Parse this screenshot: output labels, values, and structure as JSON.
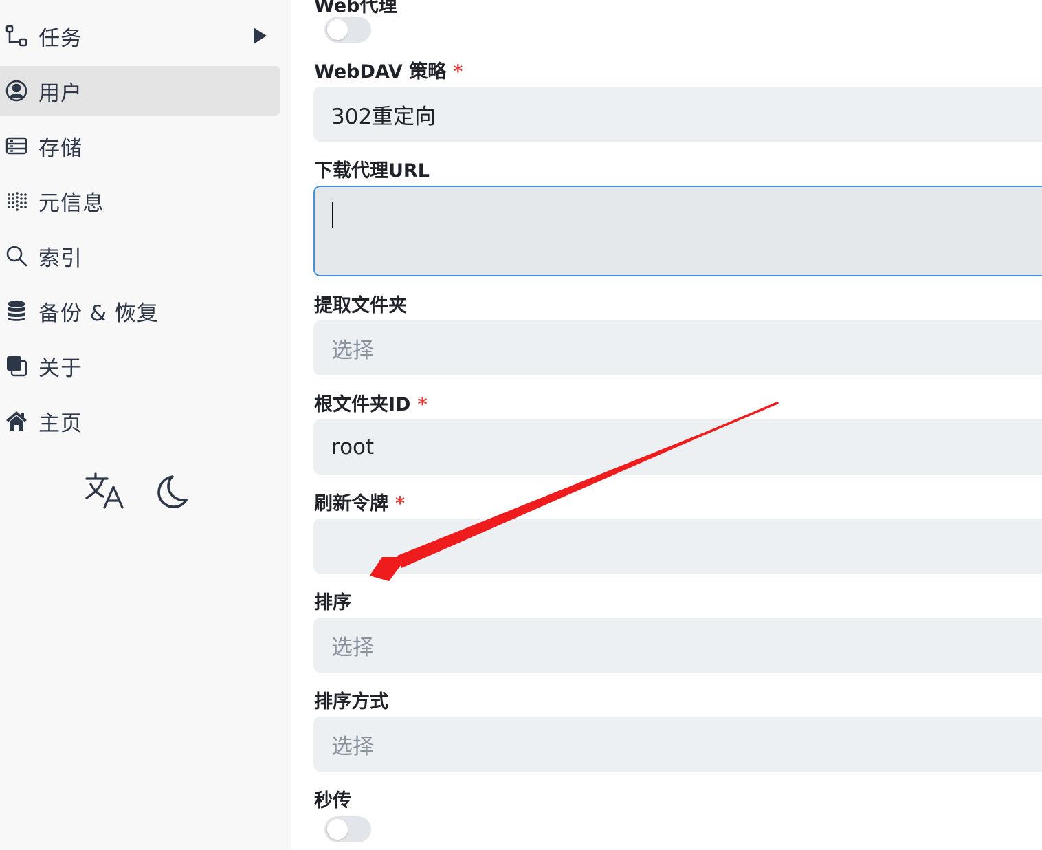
{
  "sidebar": {
    "items": [
      {
        "label": "任务",
        "icon": "flow-icon",
        "expandable": true
      },
      {
        "label": "用户",
        "icon": "user-circle-icon",
        "active": true
      },
      {
        "label": "存储",
        "icon": "storage-icon"
      },
      {
        "label": "元信息",
        "icon": "metadata-icon"
      },
      {
        "label": "索引",
        "icon": "search-icon"
      },
      {
        "label": "备份 & 恢复",
        "icon": "database-icon"
      },
      {
        "label": "关于",
        "icon": "about-icon"
      },
      {
        "label": "主页",
        "icon": "home-icon"
      }
    ],
    "footer": {
      "language_icon": "translate-icon",
      "theme_icon": "moon-icon"
    }
  },
  "form": {
    "web_proxy": {
      "label": "Web代理",
      "enabled": false
    },
    "webdav_policy": {
      "label": "WebDAV 策略",
      "required": "*",
      "value": "302重定向"
    },
    "download_proxy_url": {
      "label": "下载代理URL",
      "value": ""
    },
    "extract_folder": {
      "label": "提取文件夹",
      "placeholder": "选择"
    },
    "root_folder_id": {
      "label": "根文件夹ID",
      "required": "*",
      "value": "root"
    },
    "refresh_token": {
      "label": "刷新令牌",
      "required": "*",
      "value": ""
    },
    "order_by": {
      "label": "排序",
      "placeholder": "选择"
    },
    "order_direction": {
      "label": "排序方式",
      "placeholder": "选择"
    },
    "rapid_upload": {
      "label": "秒传",
      "enabled": false
    }
  },
  "colors": {
    "required": "#e53e3e",
    "annotation_arrow": "#ee1c1c",
    "focus_border": "#4a90d9"
  }
}
